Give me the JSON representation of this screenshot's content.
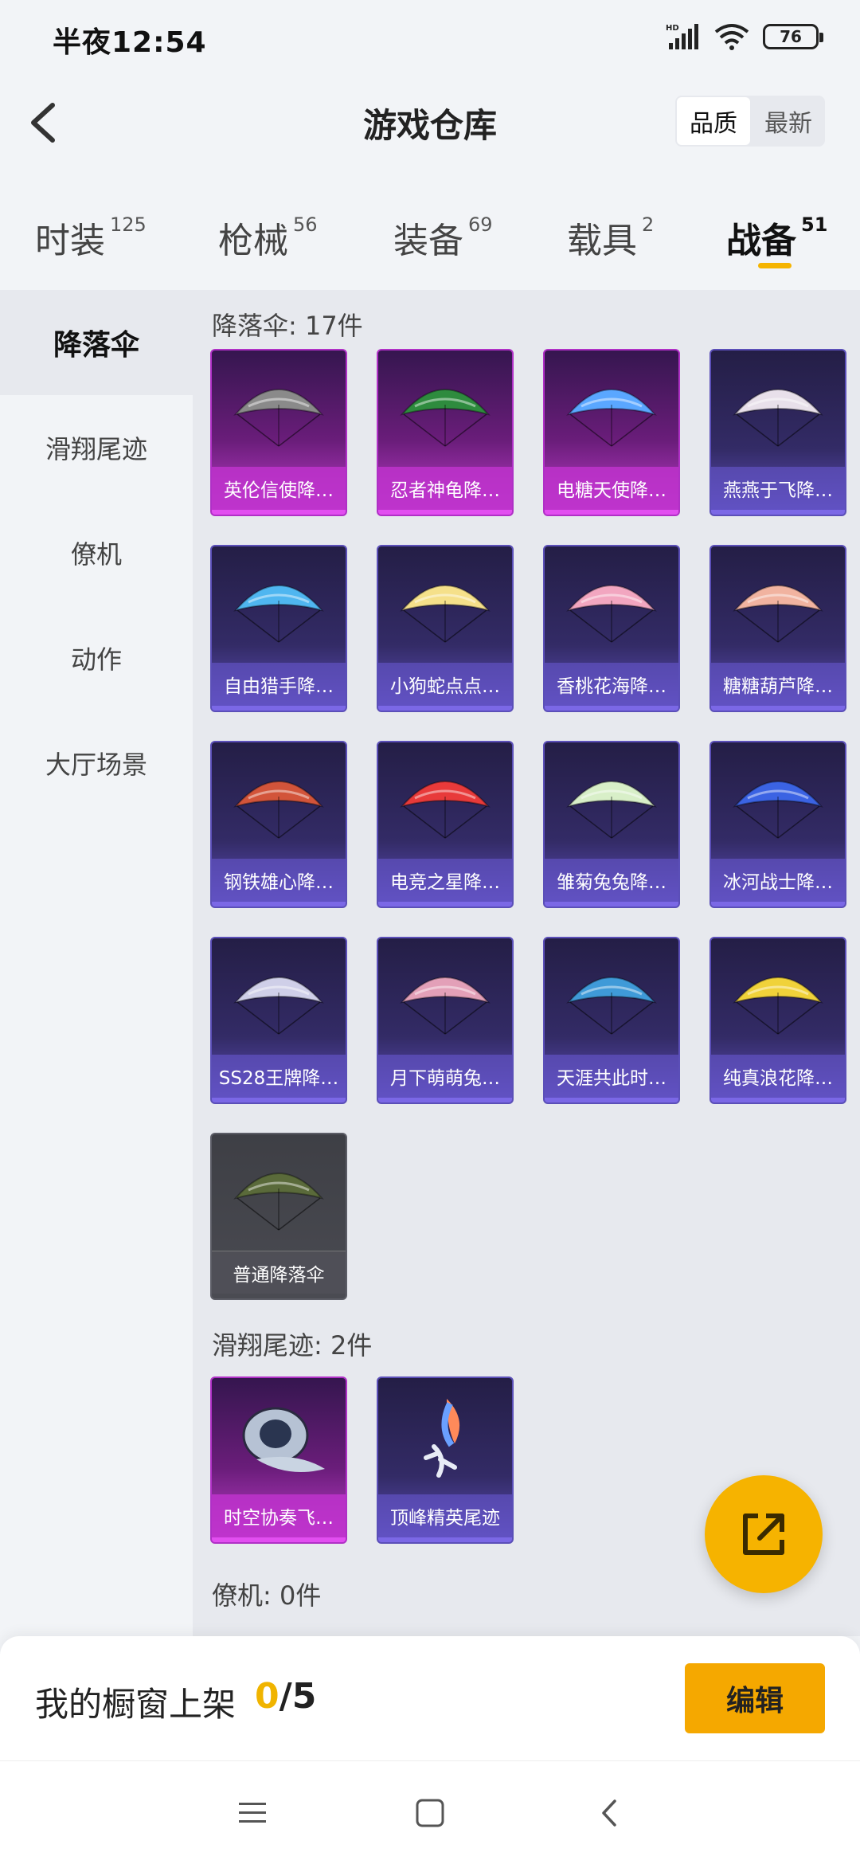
{
  "status": {
    "time": "半夜12:54",
    "battery": "76",
    "network": "HD"
  },
  "header": {
    "title": "游戏仓库",
    "sort": {
      "quality": "品质",
      "latest": "最新"
    }
  },
  "tabs": [
    {
      "label": "时装",
      "count": "125"
    },
    {
      "label": "枪械",
      "count": "56"
    },
    {
      "label": "装备",
      "count": "69"
    },
    {
      "label": "载具",
      "count": "2"
    },
    {
      "label": "战备",
      "count": "51"
    }
  ],
  "sidebar": {
    "items": [
      {
        "label": "降落伞"
      },
      {
        "label": "滑翔尾迹"
      },
      {
        "label": "僚机"
      },
      {
        "label": "动作"
      },
      {
        "label": "大厅场景"
      }
    ]
  },
  "sections": {
    "parachute": {
      "title": "降落伞: 17件",
      "items": [
        {
          "name": "英伦信使降…",
          "rarity": "pink",
          "color": "#8a8a8a"
        },
        {
          "name": "忍者神龟降…",
          "rarity": "pink",
          "color": "#2e8b3e"
        },
        {
          "name": "电糖天使降…",
          "rarity": "pink",
          "color": "#5aa7ff"
        },
        {
          "name": "燕燕于飞降…",
          "rarity": "purple",
          "color": "#e8e0ea"
        },
        {
          "name": "自由猎手降…",
          "rarity": "purple",
          "color": "#4fb6f0"
        },
        {
          "name": "小狗蛇点点…",
          "rarity": "purple",
          "color": "#f5e08a"
        },
        {
          "name": "香桃花海降…",
          "rarity": "purple",
          "color": "#f2a6c0"
        },
        {
          "name": "糖糖葫芦降…",
          "rarity": "purple",
          "color": "#f1b3a0"
        },
        {
          "name": "钢铁雄心降…",
          "rarity": "purple",
          "color": "#d2543a"
        },
        {
          "name": "电竞之星降…",
          "rarity": "purple",
          "color": "#e83a3a"
        },
        {
          "name": "雏菊兔兔降…",
          "rarity": "purple",
          "color": "#d8efc8"
        },
        {
          "name": "冰河战士降…",
          "rarity": "purple",
          "color": "#3b63e3"
        },
        {
          "name": "SS28王牌降…",
          "rarity": "purple",
          "color": "#cfcfe8"
        },
        {
          "name": "月下萌萌兔…",
          "rarity": "purple",
          "color": "#e3a0b8"
        },
        {
          "name": "天涯共此时…",
          "rarity": "purple",
          "color": "#3f9ad8"
        },
        {
          "name": "纯真浪花降…",
          "rarity": "purple",
          "color": "#f0d23a"
        },
        {
          "name": "普通降落伞",
          "rarity": "gray",
          "color": "#5a6a3a"
        }
      ]
    },
    "trail": {
      "title": "滑翔尾迹: 2件",
      "items": [
        {
          "name": "时空协奏飞…",
          "rarity": "pink",
          "color": "#b6c2d4"
        },
        {
          "name": "顶峰精英尾迹",
          "rarity": "purple",
          "color": "#e48a6a"
        }
      ]
    },
    "wingman": {
      "title": "僚机: 0件"
    }
  },
  "showcase": {
    "label": "我的橱窗上架",
    "current": "0",
    "total": "/5",
    "edit": "编辑"
  },
  "colors": {
    "accent": "#f5b400",
    "pink_rarity": "#c23ecf",
    "purple_rarity": "#5b4fb8"
  }
}
